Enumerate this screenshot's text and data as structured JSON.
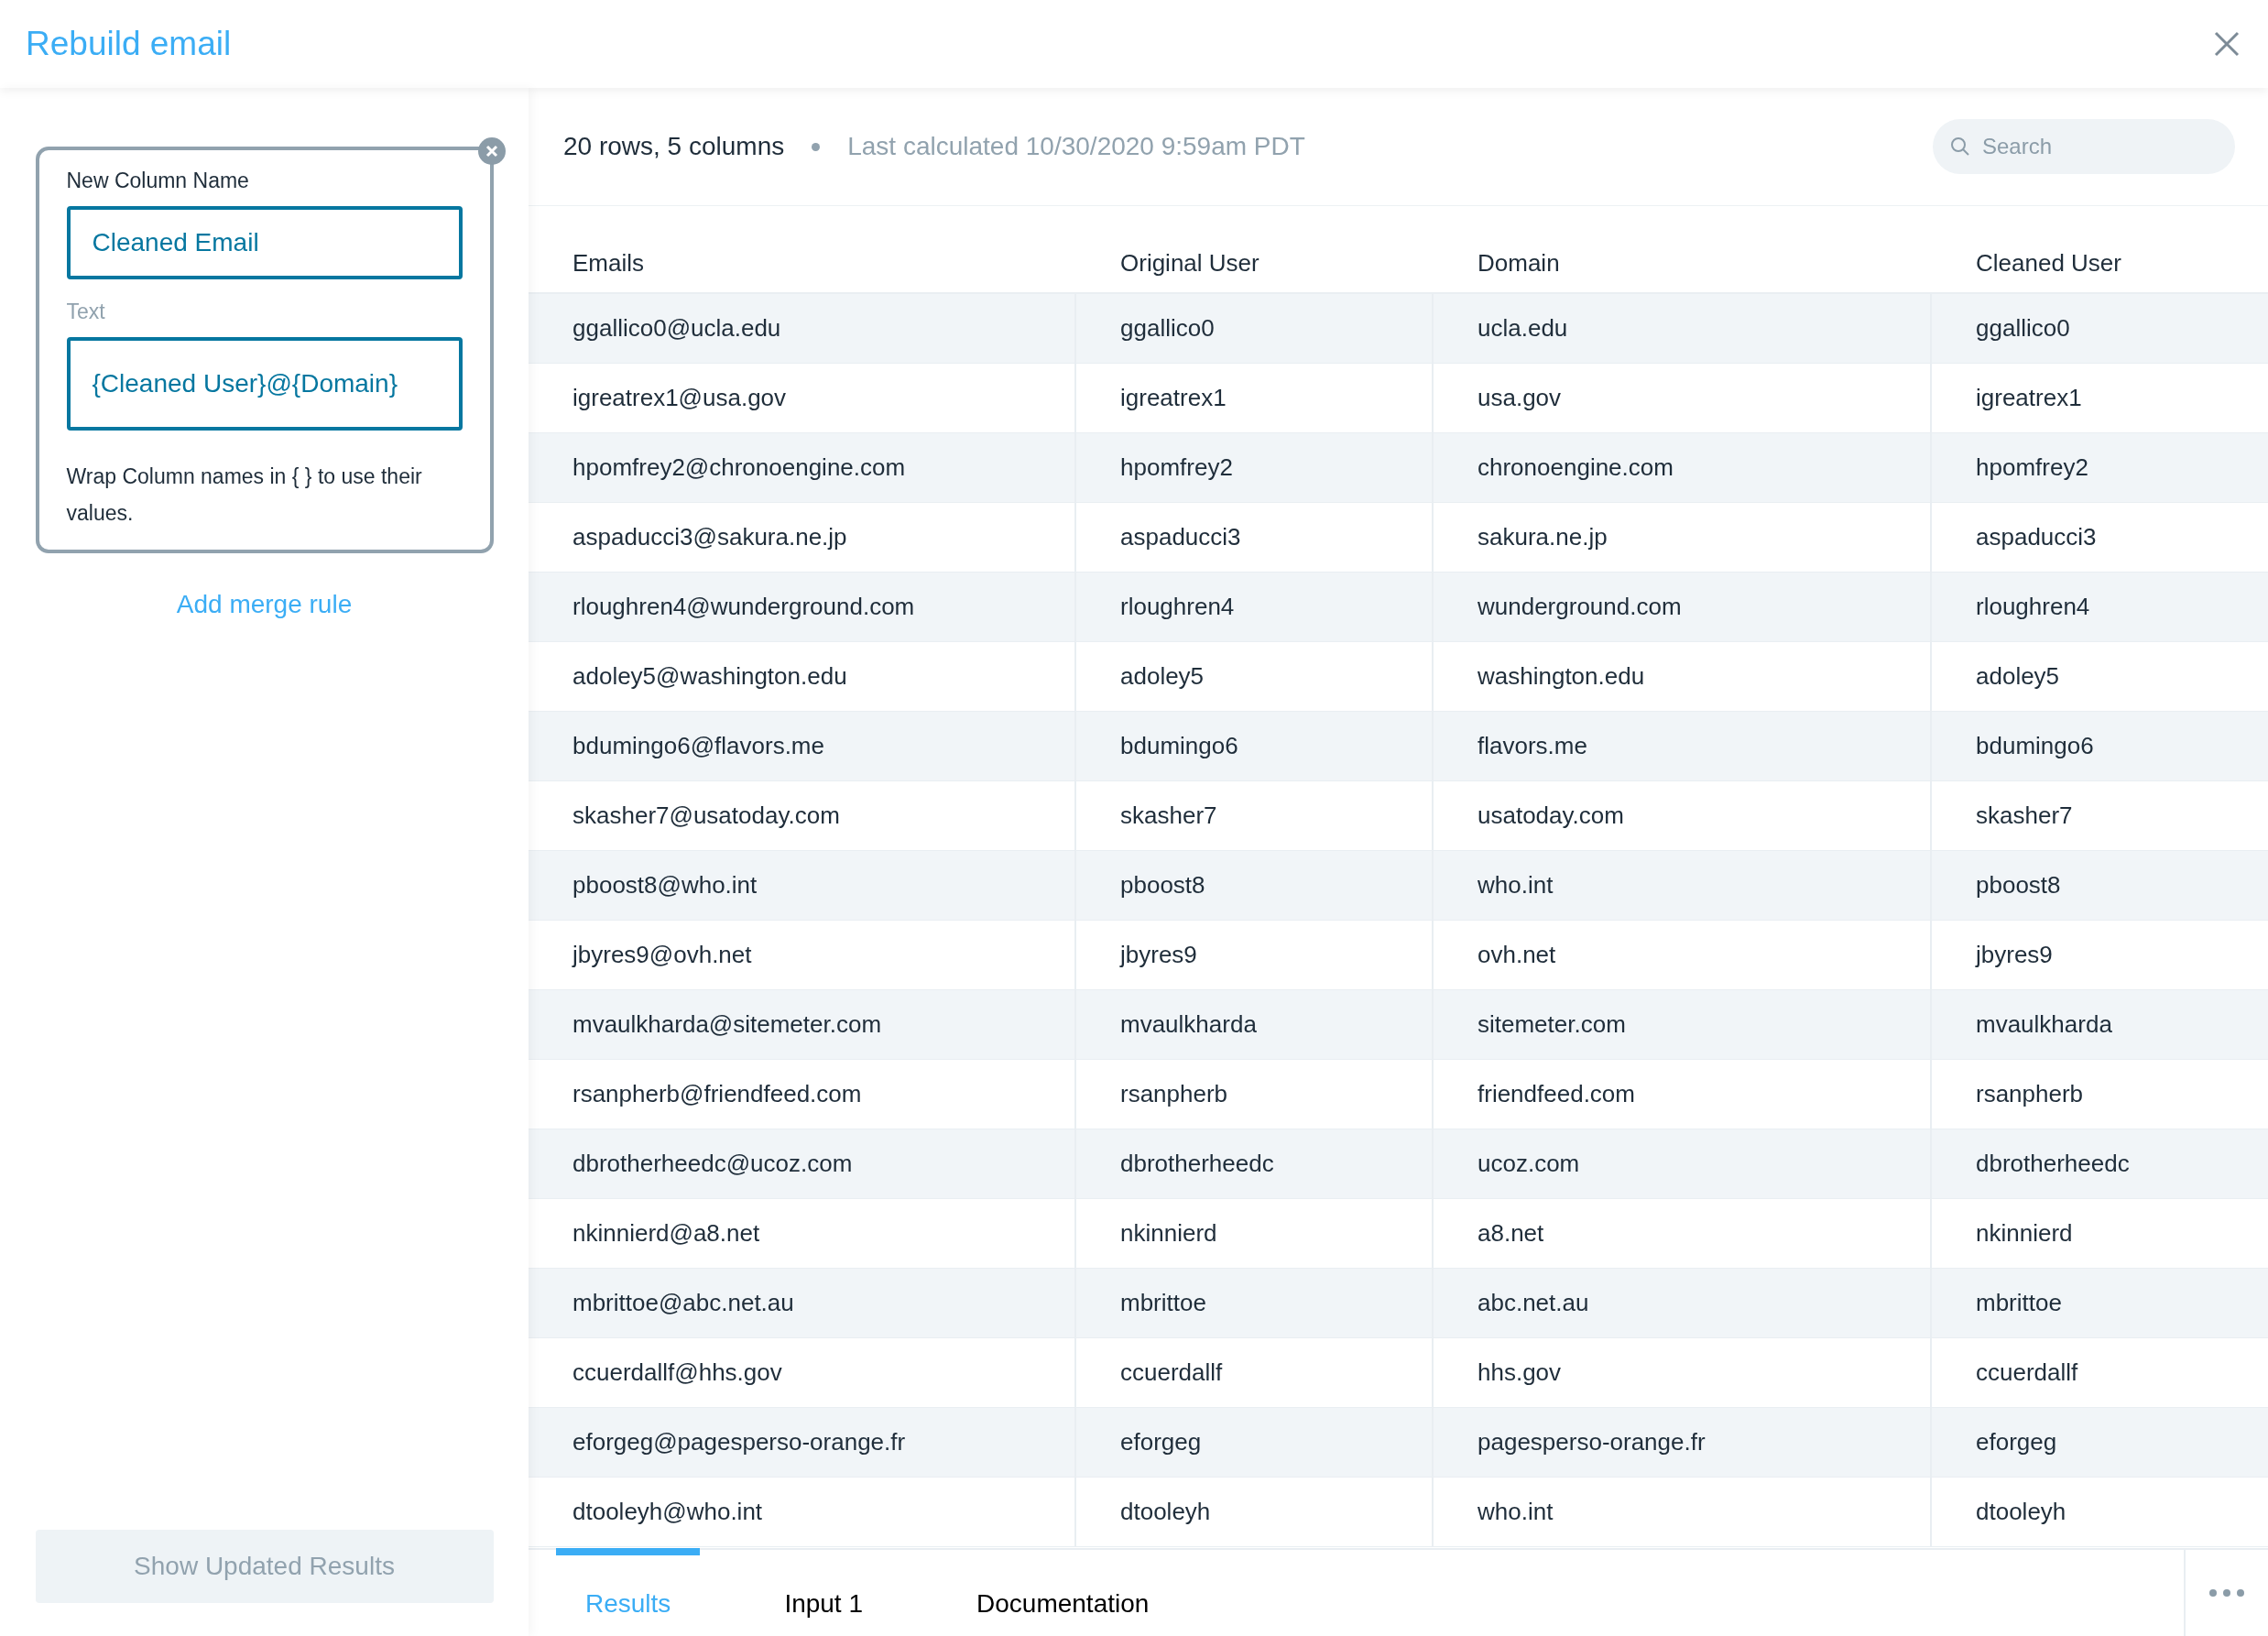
{
  "window": {
    "title": "Rebuild email"
  },
  "rule_card": {
    "name_label": "New Column Name",
    "name_value": "Cleaned Email",
    "text_label": "Text",
    "text_value": "{Cleaned User}@{Domain}",
    "hint": "Wrap Column names in { } to use their values."
  },
  "add_rule_link": "Add merge rule",
  "show_results_button": {
    "label": "Show Updated Results",
    "disabled": true
  },
  "summary": {
    "size": "20 rows, 5 columns",
    "calculated": "Last calculated 10/30/2020 9:59am PDT"
  },
  "search": {
    "placeholder": "Search"
  },
  "table": {
    "columns": [
      "Emails",
      "Original User",
      "Domain",
      "Cleaned User"
    ],
    "rows": [
      [
        "ggallico0@ucla.edu",
        "ggallico0",
        "ucla.edu",
        "ggallico0"
      ],
      [
        "igreatrex1@usa.gov",
        "igreatrex1",
        "usa.gov",
        "igreatrex1"
      ],
      [
        "hpomfrey2@chronoengine.com",
        "hpomfrey2",
        "chronoengine.com",
        "hpomfrey2"
      ],
      [
        "aspaducci3@sakura.ne.jp",
        "aspaducci3",
        "sakura.ne.jp",
        "aspaducci3"
      ],
      [
        "rloughren4@wunderground.com",
        "rloughren4",
        "wunderground.com",
        "rloughren4"
      ],
      [
        "adoley5@washington.edu",
        "adoley5",
        "washington.edu",
        "adoley5"
      ],
      [
        "bdumingo6@flavors.me",
        "bdumingo6",
        "flavors.me",
        "bdumingo6"
      ],
      [
        "skasher7@usatoday.com",
        "skasher7",
        "usatoday.com",
        "skasher7"
      ],
      [
        "pboost8@who.int",
        "pboost8",
        "who.int",
        "pboost8"
      ],
      [
        "jbyres9@ovh.net",
        "jbyres9",
        "ovh.net",
        "jbyres9"
      ],
      [
        "mvaulkharda@sitemeter.com",
        "mvaulkharda",
        "sitemeter.com",
        "mvaulkharda"
      ],
      [
        "rsanpherb@friendfeed.com",
        "rsanpherb",
        "friendfeed.com",
        "rsanpherb"
      ],
      [
        "dbrotherheedc@ucoz.com",
        "dbrotherheedc",
        "ucoz.com",
        "dbrotherheedc"
      ],
      [
        "nkinnierd@a8.net",
        "nkinnierd",
        "a8.net",
        "nkinnierd"
      ],
      [
        "mbrittoe@abc.net.au",
        "mbrittoe",
        "abc.net.au",
        "mbrittoe"
      ],
      [
        "ccuerdallf@hhs.gov",
        "ccuerdallf",
        "hhs.gov",
        "ccuerdallf"
      ],
      [
        "eforgeg@pagesperso-orange.fr",
        "eforgeg",
        "pagesperso-orange.fr",
        "eforgeg"
      ],
      [
        "dtooleyh@who.int",
        "dtooleyh",
        "who.int",
        "dtooleyh"
      ]
    ]
  },
  "tabs": [
    {
      "label": "Results",
      "selected": true
    },
    {
      "label": "Input 1",
      "selected": false
    },
    {
      "label": "Documentation",
      "selected": false
    }
  ]
}
